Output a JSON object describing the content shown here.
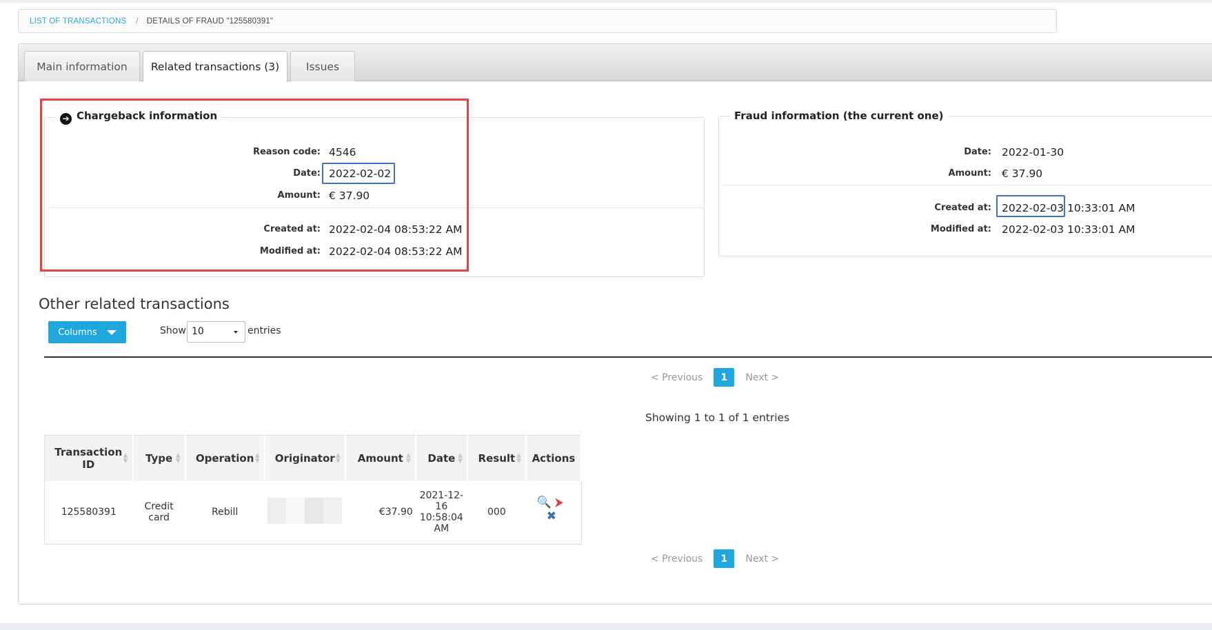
{
  "breadcrumb": {
    "link_label": "LIST OF TRANSACTIONS",
    "separator": "/",
    "current": "DETAILS OF FRAUD \"125580391\""
  },
  "tabs": [
    {
      "label": "Main information"
    },
    {
      "label": "Related transactions (3)"
    },
    {
      "label": "Issues"
    }
  ],
  "chargeback": {
    "title": "Chargeback information",
    "icon": "arrow-circle-right-icon",
    "reason_code_label": "Reason code:",
    "reason_code": "4546",
    "date_label": "Date:",
    "date": "2022-02-02",
    "amount_label": "Amount:",
    "amount": "€ 37.90",
    "created_label": "Created at:",
    "created": "2022-02-04 08:53:22 AM",
    "modified_label": "Modified at:",
    "modified": "2022-02-04 08:53:22 AM"
  },
  "fraud": {
    "title": "Fraud information (the current one)",
    "date_label": "Date:",
    "date": "2022-01-30",
    "amount_label": "Amount:",
    "amount": "€ 37.90",
    "created_label": "Created at:",
    "created_date": "2022-02-03",
    "created_time": " 10:33:01 AM",
    "modified_label": "Modified at:",
    "modified": "2022-02-03 10:33:01 AM"
  },
  "related": {
    "title": "Other related transactions",
    "columns_button": "Columns",
    "show_label": "Show",
    "entries_value": "10",
    "entries_label": "entries",
    "pager": {
      "previous": "< Previous",
      "page": "1",
      "next": "Next >"
    },
    "info": "Showing 1 to 1 of 1 entries",
    "headers": [
      "Transaction ID",
      "Type",
      "Operation",
      "Originator",
      "Amount",
      "Date",
      "Result",
      "Actions"
    ],
    "rows": [
      {
        "transaction_id": "125580391",
        "type": "Credit card",
        "operation": "Rebill",
        "originator": "",
        "amount": "€37.90",
        "date": "2021-12-16 10:58:04 AM",
        "result": "000"
      }
    ]
  },
  "colors": {
    "accent": "#1fa6dc",
    "highlight_red": "#e84141",
    "highlight_blue": "#3f6fd1"
  }
}
